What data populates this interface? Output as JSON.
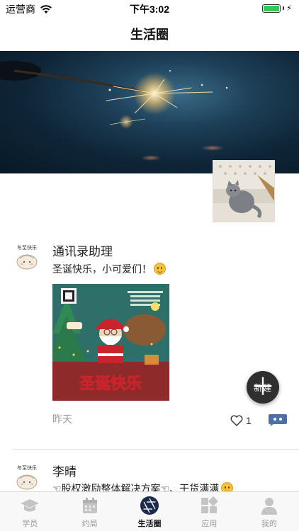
{
  "status_bar": {
    "carrier": "运营商",
    "time": "下午3:02",
    "battery_level": 1.0
  },
  "nav": {
    "title": "生活圈"
  },
  "posts": [
    {
      "author": "通讯录助理",
      "avatar_caption": "冬至快乐",
      "text": "圣诞快乐，小可爱们！",
      "emoji": "smile-emoji",
      "image_caption": "圣诞快乐",
      "time": "昨天",
      "likes": "1"
    },
    {
      "author": "李晴",
      "avatar_caption": "冬至快乐",
      "text_before": "☜股权激励整体解决方案☜、干货满满",
      "emoji": "smile-emoji"
    }
  ],
  "fab": {
    "label": "新建"
  },
  "tabs": [
    {
      "label": "学员",
      "icon": "graduation-cap-icon",
      "active": false
    },
    {
      "label": "约局",
      "icon": "calendar-icon",
      "active": false
    },
    {
      "label": "生活圈",
      "icon": "aperture-icon",
      "active": true
    },
    {
      "label": "应用",
      "icon": "apps-grid-icon",
      "active": false
    },
    {
      "label": "我的",
      "icon": "person-icon",
      "active": false
    }
  ],
  "colors": {
    "active_tab": "#1a1a1a",
    "inactive_tab": "#9a9a9a",
    "battery": "#35c759",
    "comment_icon": "#4e6fa8"
  }
}
